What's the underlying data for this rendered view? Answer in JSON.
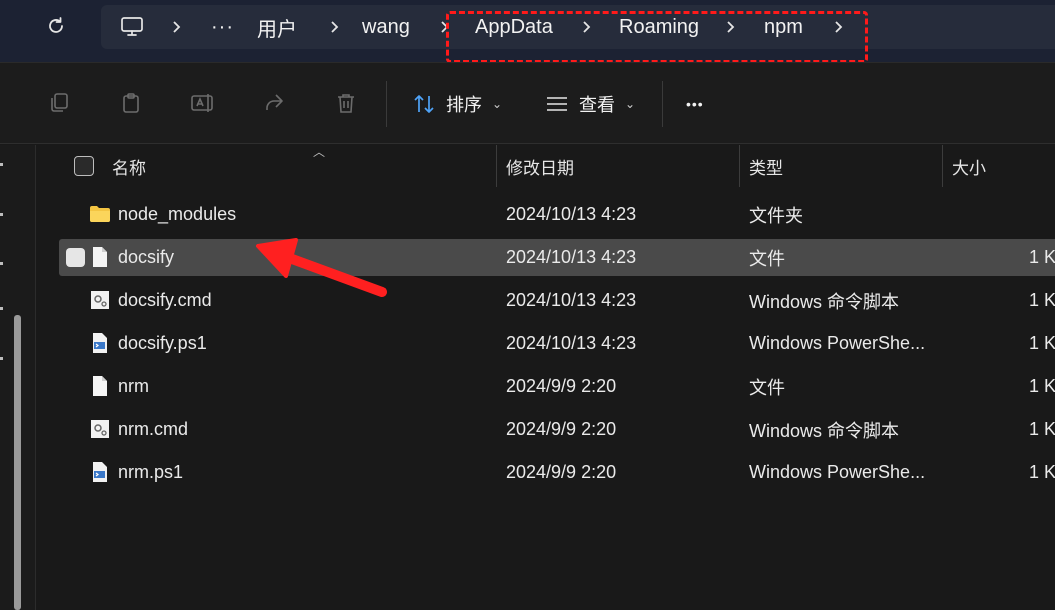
{
  "address": {
    "refresh_icon": "refresh-icon",
    "crumbs": [
      {
        "label": "",
        "icon": "computer-icon"
      },
      {
        "label": "···"
      },
      {
        "label": "用户"
      },
      {
        "label": "wang"
      },
      {
        "label": "AppData"
      },
      {
        "label": "Roaming"
      },
      {
        "label": "npm"
      }
    ],
    "highlight_color": "#ff1a1a"
  },
  "toolbar": {
    "icons": [
      "copy-icon",
      "paste-icon",
      "rename-icon",
      "share-icon",
      "delete-icon"
    ],
    "sort_label": "排序",
    "view_label": "查看",
    "more_label": "•••"
  },
  "columns": {
    "name": "名称",
    "modified": "修改日期",
    "type": "类型",
    "size": "大小"
  },
  "files": [
    {
      "name": "node_modules",
      "date": "2024/10/13 4:23",
      "type": "文件夹",
      "size": "",
      "icon": "folder-icon"
    },
    {
      "name": "docsify",
      "date": "2024/10/13 4:23",
      "type": "文件",
      "size": "1 K",
      "icon": "file-icon",
      "selected": true
    },
    {
      "name": "docsify.cmd",
      "date": "2024/10/13 4:23",
      "type": "Windows 命令脚本",
      "size": "1 K",
      "icon": "cmd-script-icon"
    },
    {
      "name": "docsify.ps1",
      "date": "2024/10/13 4:23",
      "type": "Windows PowerShe...",
      "size": "1 K",
      "icon": "powershell-script-icon"
    },
    {
      "name": "nrm",
      "date": "2024/9/9 2:20",
      "type": "文件",
      "size": "1 K",
      "icon": "file-icon"
    },
    {
      "name": "nrm.cmd",
      "date": "2024/9/9 2:20",
      "type": "Windows 命令脚本",
      "size": "1 K",
      "icon": "cmd-script-icon"
    },
    {
      "name": "nrm.ps1",
      "date": "2024/9/9 2:20",
      "type": "Windows PowerShe...",
      "size": "1 K",
      "icon": "powershell-script-icon"
    }
  ],
  "annotation": {
    "arrow_color": "#ff2020"
  }
}
